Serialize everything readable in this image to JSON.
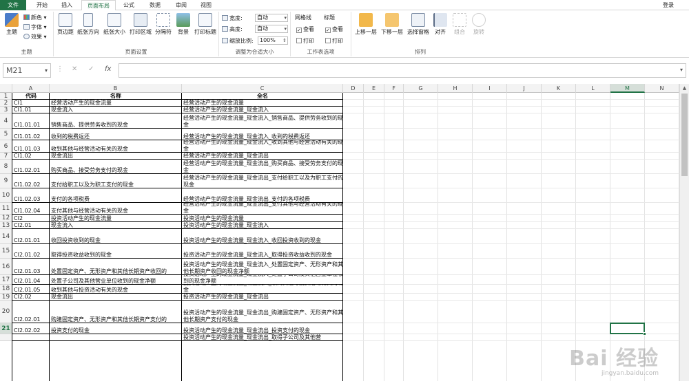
{
  "tabs": [
    "文件",
    "开始",
    "插入",
    "页面布局",
    "公式",
    "数据",
    "审阅",
    "视图"
  ],
  "active_tab": 3,
  "login_label": "登录",
  "ribbon": {
    "theme": {
      "main_label": "主题",
      "color_label": "颜色",
      "font_label": "字体",
      "effect_label": "效果",
      "group_label": "主题"
    },
    "page_setup": {
      "buttons": [
        "页边距",
        "纸张方向",
        "纸张大小",
        "打印区域",
        "分隔符",
        "背景",
        "打印标题"
      ],
      "group_label": "页面设置"
    },
    "scale": {
      "width_label": "宽度:",
      "width_value": "自动",
      "height_label": "高度:",
      "height_value": "自动",
      "zoom_label": "缩放比例:",
      "zoom_value": "100%",
      "group_label": "调整为合适大小"
    },
    "sheet_options": {
      "gridlines_label": "网格线",
      "headings_label": "标题",
      "view_label": "查看",
      "print_label": "打印",
      "group_label": "工作表选项"
    },
    "arrange": {
      "buttons": [
        "上移一层",
        "下移一层",
        "选择窗格",
        "对齐",
        "组合",
        "旋转"
      ],
      "group_label": "排列"
    }
  },
  "formula_bar": {
    "name_box": "M21",
    "formula": ""
  },
  "columns": [
    "A",
    "B",
    "C",
    "D",
    "E",
    "F",
    "G",
    "H",
    "I",
    "J",
    "K",
    "L",
    "M",
    "N"
  ],
  "selected_column": "M",
  "selected_row": "21",
  "rows": [
    {
      "num": "1",
      "a": "代码",
      "b": "名称",
      "c": "全名"
    },
    {
      "num": "2",
      "a": "CI1",
      "b": "经营活动产生的现金流量",
      "c": "经营活动产生的现金流量"
    },
    {
      "num": "3",
      "a": "CI1.01",
      "b": "现金流入",
      "c": "经营活动产生的现金流量_现金流入"
    },
    {
      "num": "4",
      "a": "CI1.01.01",
      "b": "销售商品、提供劳务收到的现金",
      "c": "经营活动产生的现金流量_现金流入_销售商品、提供劳务收到的现金"
    },
    {
      "num": "5",
      "a": "CI1.01.02",
      "b": "收到的税费返还",
      "c": "经营活动产生的现金流量_现金流入_收到的税费返还"
    },
    {
      "num": "6",
      "a": "CI1.01.03",
      "b": "收到其他与经营活动有关的现金",
      "c": "经营活动产生的现金流量_现金流入_收到其他与经营活动有关的现金"
    },
    {
      "num": "7",
      "a": "CI1.02",
      "b": "现金流出",
      "c": "经营活动产生的现金流量_现金流出"
    },
    {
      "num": "8",
      "a": "CI1.02.01",
      "b": "购买商品、接受劳务支付的现金",
      "c": "经营活动产生的现金流量_现金流出_购买商品、接受劳务支付的现金"
    },
    {
      "num": "9",
      "a": "CI1.02.02",
      "b": "支付给职工以及为职工支付的现金",
      "c": "经营活动产生的现金流量_现金流出_支付给职工以及为职工支付的现金"
    },
    {
      "num": "10",
      "a": "CI1.02.03",
      "b": "支付的各项税费",
      "c": "经营活动产生的现金流量_现金流出_支付的各项税费"
    },
    {
      "num": "11",
      "a": "CI1.02.04",
      "b": "支付其他与经营活动有关的现金",
      "c": "经营活动产生的现金流量_现金流出_支付其他与经营活动有关的现金"
    },
    {
      "num": "12",
      "a": "CI2",
      "b": "投资活动产生的现金流量",
      "c": "投资活动产生的现金流量"
    },
    {
      "num": "13",
      "a": "CI2.01",
      "b": "现金流入",
      "c": "投资活动产生的现金流量_现金流入"
    },
    {
      "num": "14",
      "a": "CI2.01.01",
      "b": "收回投资收到的现金",
      "c": "投资活动产生的现金流量_现金流入_收回投资收到的现金"
    },
    {
      "num": "15",
      "a": "CI2.01.02",
      "b": "取得投资收益收到的现金",
      "c": "投资活动产生的现金流量_现金流入_取得投资收益收到的现金"
    },
    {
      "num": "16",
      "a": "CI2.01.03",
      "b": "处置固定资产、无形资产和其他长期资产收回的",
      "c": "投资活动产生的现金流量_现金流入_处置固定资产、无形资产和其他长期资产收回的现金净额"
    },
    {
      "num": "17",
      "a": "CI2.01.04",
      "b": "处置子公司及其他营业单位收到的现金净额",
      "c": "投资活动产生的现金流量_现金流入_处置子公司及其他营业单位收到的现金净额"
    },
    {
      "num": "18",
      "a": "CI2.01.05",
      "b": "收到其他与投资活动有关的现金",
      "c": "投资活动产生的现金流量_现金流入_收到其他与投资活动有关的现金"
    },
    {
      "num": "19",
      "a": "CI2.02",
      "b": "现金流出",
      "c": "投资活动产生的现金流量_现金流出"
    },
    {
      "num": "20",
      "a": "CI2.02.01",
      "b": "购建固定资产、无形资产和其他长期资产支付的",
      "c": "投资活动产生的现金流量_现金流出_购建固定资产、无形资产和其他长期资产支付的现金"
    },
    {
      "num": "21",
      "a": "CI2.02.02",
      "b": "投资支付的现金",
      "c": "投资活动产生的现金流量_现金流出_投资支付的现金"
    },
    {
      "num": "",
      "a": "",
      "b": "",
      "c": "投资活动产生的现金流量_现金流出_取得子公司及其他营"
    }
  ],
  "watermark": {
    "line1": "Bai 经验",
    "line2": "jingyan.baidu.com"
  }
}
